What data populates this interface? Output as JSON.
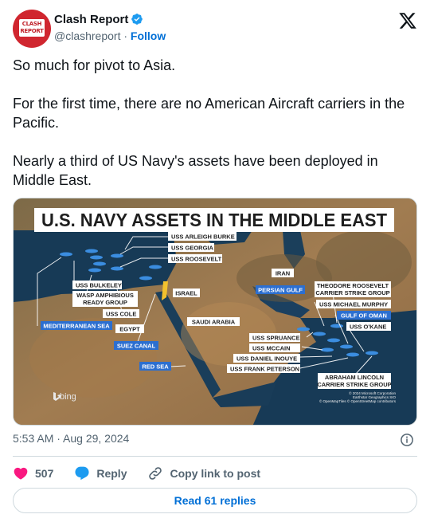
{
  "author": {
    "display_name": "Clash Report",
    "handle": "@clashreport",
    "separator": " · ",
    "follow_label": "Follow",
    "avatar_text": "CLASH REPORT"
  },
  "tweet": {
    "paragraphs": [
      "So much for pivot to Asia.",
      "For the first time, there are no American Aircraft carriers in the Pacific.",
      "Nearly a third of US Navy's assets have been deployed in Middle East."
    ]
  },
  "image": {
    "title": "U.S. NAVY ASSETS IN THE MIDDLE EAST",
    "ship_labels": [
      "USS ARLEIGH BURKE",
      "USS GEORGIA",
      "USS ROOSEVELT",
      "USS BULKELEY",
      "WASP AMPHIBIOUS",
      "READY GROUP",
      "USS COLE",
      "THEODORE ROOSEVELT",
      "CARRIER STRIKE GROUP",
      "USS MICHAEL MURPHY",
      "USS O'KANE",
      "USS SPRUANCE",
      "USS MCCAIN",
      "USS DANIEL INOUYE",
      "USS FRANK PETERSON",
      "ABRAHAM LINCOLN",
      "CARRIER STRIKE GROUP"
    ],
    "place_labels": {
      "iran": "IRAN",
      "israel": "ISRAEL",
      "egypt": "EGYPT",
      "saudi_arabia": "SAUDI ARABIA"
    },
    "water_labels": {
      "mediterranean": "MEDITERRANEAN SEA",
      "suez": "SUEZ CANAL",
      "red_sea": "RED SEA",
      "persian_gulf": "PERSIAN GULF",
      "gulf_of_oman": "GULF OF OMAN"
    },
    "brand": "bing",
    "credits": [
      "© 2024 Microsoft Corporation",
      "Earthstar Geographics  SIO",
      "© OpenMapTiles © OpenStreetMap contributors"
    ]
  },
  "meta": {
    "timestamp": "5:53 AM · Aug 29, 2024"
  },
  "actions": {
    "likes": "507",
    "reply_label": "Reply",
    "copy_label": "Copy link to post"
  },
  "read_replies_label": "Read 61 replies",
  "colors": {
    "like": "#f91880",
    "reply": "#1d9bf0",
    "link": "#006fd6",
    "avatar": "#d0262f",
    "label_blue": "#2c6fd0"
  }
}
